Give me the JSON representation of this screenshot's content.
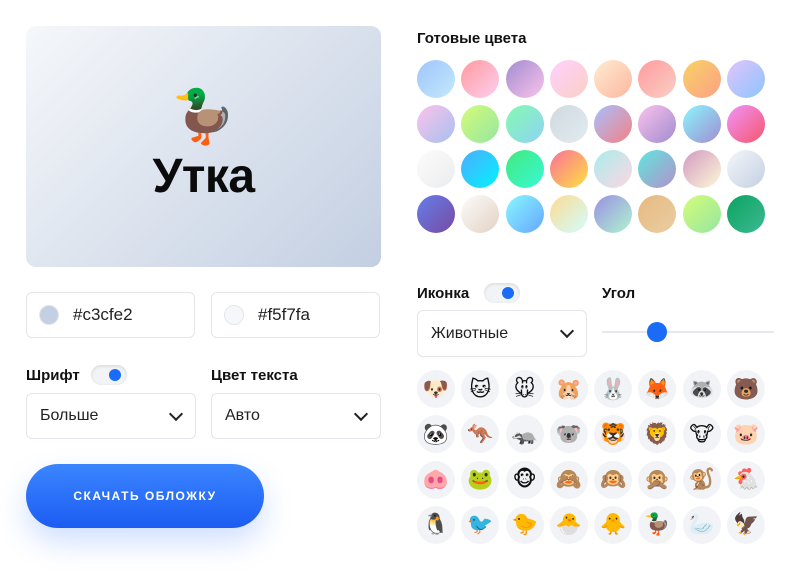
{
  "preview": {
    "emoji": "🦆",
    "title": "Утка",
    "gradient_start": "#f5f7fa",
    "gradient_end": "#c3cfe2"
  },
  "colors": {
    "first": {
      "value": "#c3cfe2",
      "swatch": "#c3cfe2"
    },
    "second": {
      "value": "#f5f7fa",
      "swatch": "#f5f7fa"
    }
  },
  "font": {
    "label": "Шрифт",
    "enabled": true,
    "selected": "Больше"
  },
  "text_color": {
    "label": "Цвет текста",
    "selected": "Авто"
  },
  "download_button": "СКАЧАТЬ ОБЛОЖКУ",
  "ready_colors": {
    "label": "Готовые цвета",
    "gradients": [
      [
        "#a1c4fd",
        "#c2e9fb"
      ],
      [
        "#ff9a9e",
        "#fecfef"
      ],
      [
        "#a18cd1",
        "#fbc2eb"
      ],
      [
        "#ffd1ff",
        "#fad0c4"
      ],
      [
        "#ffecd2",
        "#fcb69f"
      ],
      [
        "#ff9a9e",
        "#fad0c4"
      ],
      [
        "#f6d365",
        "#fda085"
      ],
      [
        "#e0c3fc",
        "#8ec5fc"
      ],
      [
        "#fbc2eb",
        "#a6c1ee"
      ],
      [
        "#d4fc79",
        "#96e6a1"
      ],
      [
        "#84fab0",
        "#8fd3f4"
      ],
      [
        "#cfd9df",
        "#e2ebf0"
      ],
      [
        "#a6c0fe",
        "#f68084"
      ],
      [
        "#fbc2eb",
        "#a18cd1"
      ],
      [
        "#89f7fe",
        "#a18cd1"
      ],
      [
        "#f093fb",
        "#f5576c"
      ],
      [
        "#fdfbfb",
        "#ebedee"
      ],
      [
        "#4facfe",
        "#00f2fe"
      ],
      [
        "#43e97b",
        "#38f9d7"
      ],
      [
        "#fa709a",
        "#fee140"
      ],
      [
        "#a8edea",
        "#fed6e3"
      ],
      [
        "#5ee7df",
        "#b490ca"
      ],
      [
        "#d299c2",
        "#fef9d7"
      ],
      [
        "#f5f7fa",
        "#c3cfe2"
      ],
      [
        "#667eea",
        "#764ba2"
      ],
      [
        "#fdfcfb",
        "#e2d1c3"
      ],
      [
        "#89f7fe",
        "#66a6ff"
      ],
      [
        "#fddb92",
        "#d1fdff"
      ],
      [
        "#9890e3",
        "#b1f4cf"
      ],
      [
        "#e6b980",
        "#eacda3"
      ],
      [
        "#d4fc79",
        "#96e6a1"
      ],
      [
        "#0ba360",
        "#3cba92"
      ]
    ]
  },
  "icon": {
    "label": "Иконка",
    "enabled": true,
    "category": "Животные"
  },
  "angle": {
    "label": "Угол",
    "value": 0.32
  },
  "animal_icons": [
    "🐶",
    "🐱",
    "🐭",
    "🐹",
    "🐰",
    "🦊",
    "🦝",
    "🐻",
    "🐼",
    "🦘",
    "🦡",
    "🐨",
    "🐯",
    "🦁",
    "🐮",
    "🐷",
    "🐽",
    "🐸",
    "🐵",
    "🙈",
    "🙉",
    "🙊",
    "🐒",
    "🐔",
    "🐧",
    "🐦",
    "🐤",
    "🐣",
    "🐥",
    "🦆",
    "🦢",
    "🦅"
  ]
}
